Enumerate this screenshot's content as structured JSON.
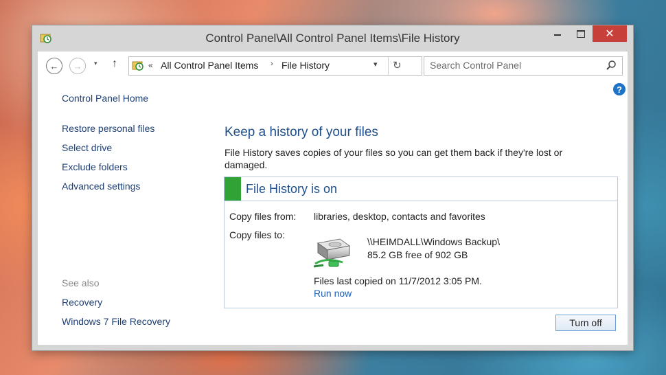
{
  "window": {
    "title": "Control Panel\\All Control Panel Items\\File History",
    "close_glyph": "✕"
  },
  "address": {
    "crumb_prefix": "«",
    "crumbs": [
      "All Control Panel Items",
      "File History"
    ],
    "separator": "›",
    "search_placeholder": "Search Control Panel"
  },
  "sidebar": {
    "home": "Control Panel Home",
    "links": [
      "Restore personal files",
      "Select drive",
      "Exclude folders",
      "Advanced settings"
    ],
    "see_also_label": "See also",
    "see_also": [
      "Recovery",
      "Windows 7 File Recovery"
    ]
  },
  "main": {
    "heading": "Keep a history of your files",
    "description": "File History saves copies of your files so you can get them back if they're lost or damaged.",
    "status": {
      "text": "File History is on",
      "color": "#31a336"
    },
    "copy_from_label": "Copy files from:",
    "copy_from_value": "libraries, desktop, contacts and favorites",
    "copy_to_label": "Copy files to:",
    "drive_path": "\\\\HEIMDALL\\Windows Backup\\",
    "drive_free": "85.2 GB free of 902 GB",
    "last_copied": "Files last copied on 11/7/2012 3:05 PM.",
    "run_now": "Run now",
    "turn_off": "Turn off"
  },
  "icons": {
    "help": "?",
    "back": "←",
    "forward": "→",
    "up": "↑",
    "refresh": "↻",
    "dropdown": "▾"
  },
  "colors": {
    "link": "#1e3f73",
    "accent": "#1e4f8c",
    "close_button": "#c7403a"
  }
}
